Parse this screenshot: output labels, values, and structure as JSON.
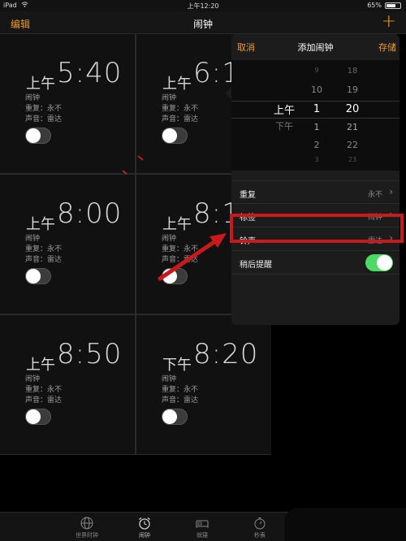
{
  "status_bar": {
    "device": "iPad",
    "time": "上午12:20",
    "battery": "65%"
  },
  "nav": {
    "edit": "编辑",
    "title": "闹钟"
  },
  "alarms": [
    {
      "ampm": "上午",
      "time": "5:40",
      "label": "闹钟",
      "repeat": "重复：永不",
      "sound": "声音：雷达"
    },
    {
      "ampm": "上午",
      "time": "6:1",
      "label": "闹钟",
      "repeat": "重复：永不",
      "sound": "声音：雷达"
    },
    {
      "ampm": "上午",
      "time": "8:00",
      "label": "闹钟",
      "repeat": "重复：永不",
      "sound": "声音：雷达"
    },
    {
      "ampm": "上午",
      "time": "8:1",
      "label": "闹钟",
      "repeat": "重复：永不",
      "sound": "声音：雷达"
    },
    {
      "ampm": "上午",
      "time": "8:50",
      "label": "闹钟",
      "repeat": "重复：永不",
      "sound": "声音：雷达"
    },
    {
      "ampm": "下午",
      "time": "8:20",
      "label": "闹钟",
      "repeat": "重复：永不",
      "sound": "声音：雷达"
    }
  ],
  "popover": {
    "cancel": "取消",
    "title": "添加闹钟",
    "save": "存储",
    "picker": {
      "ampm_selected": "上午",
      "ampm_other": "下午",
      "hours": [
        "9",
        "10",
        "1",
        "1",
        "2",
        "3"
      ],
      "minutes": [
        "18",
        "19",
        "20",
        "21",
        "22",
        "23"
      ]
    },
    "rows": {
      "repeat_label": "重复",
      "repeat_value": "永不",
      "label_label": "标签",
      "label_value": "闹钟",
      "sound_label": "铃声",
      "sound_value": "雷达",
      "snooze_label": "稍后提醒"
    }
  },
  "tabs": [
    {
      "label": "世界时钟",
      "icon": "globe-icon"
    },
    {
      "label": "闹钟",
      "icon": "alarm-clock-icon"
    },
    {
      "label": "就寝",
      "icon": "bed-icon"
    },
    {
      "label": "秒表",
      "icon": "stopwatch-icon"
    }
  ],
  "colors": {
    "accent": "#f09a2a",
    "highlight": "#c8191d",
    "switch_on": "#4cd964"
  }
}
